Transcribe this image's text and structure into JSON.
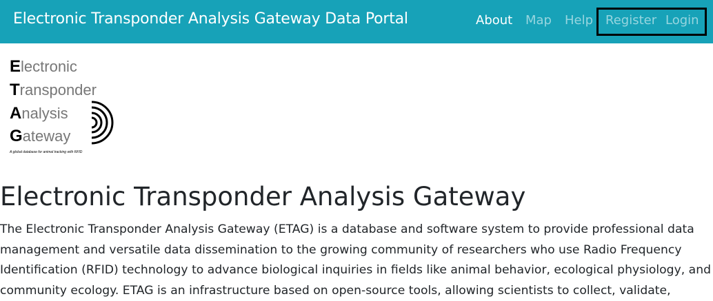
{
  "navbar": {
    "brand": "Electronic Transponder Analysis Gateway Data Portal",
    "links": [
      {
        "label": "About",
        "active": true
      },
      {
        "label": "Map",
        "active": false
      },
      {
        "label": "Help",
        "active": false
      },
      {
        "label": "Register",
        "active": false
      },
      {
        "label": "Login",
        "active": false
      }
    ],
    "color": "#17a2b8"
  },
  "logo": {
    "lines": [
      {
        "initial": "E",
        "rest": "lectronic"
      },
      {
        "initial": "T",
        "rest": "ransponder"
      },
      {
        "initial": "A",
        "rest": "nalysis"
      },
      {
        "initial": "G",
        "rest": "ateway"
      }
    ],
    "tagline": "A global database for animal tracking with RFID",
    "icon": "rfid-waves-icon"
  },
  "main": {
    "title": "Electronic Transponder Analysis Gateway",
    "intro": "The Electronic Transponder Analysis Gateway (ETAG) is a database and software system to provide professional data management and versatile data dissemination to the growing community of researchers who use Radio Frequency Identification (RFID) technology to advance biological inquiries in fields like animal behavior, ecological physiology, and community ecology. ETAG is an infrastructure based on open-source tools, allowing scientists to collect, validate,"
  }
}
